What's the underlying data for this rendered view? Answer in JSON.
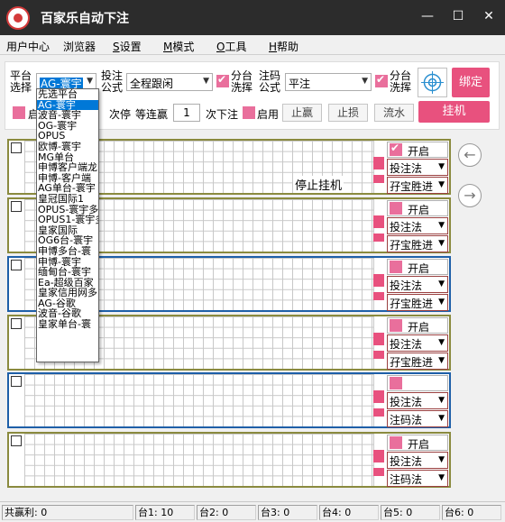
{
  "window": {
    "title": "百家乐自动下注",
    "min": "—",
    "max": "☐",
    "close": "✕"
  },
  "menu": {
    "user_center": "用户中心",
    "browser": "浏览器",
    "settings_key": "S",
    "settings": "设置",
    "mode_key": "M",
    "mode": "模式",
    "tools_key": "O",
    "tools": "工具",
    "help_key": "H",
    "help": "帮助"
  },
  "toolbar": {
    "platform_label_1": "平台",
    "platform_label_2": "选择",
    "platform_value": "AG-寰宇",
    "bet_label_1": "投注",
    "bet_label_2": "公式",
    "bet_value": "全程跟闲",
    "split_wash_1": "分台",
    "split_wash_2": "洗挥",
    "chip_label_1": "注码",
    "chip_label_2": "公式",
    "chip_value": "平注",
    "split_wash_b1": "分台",
    "split_wash_b2": "洗挥",
    "bind_button": "绑定",
    "row2_start": "启",
    "stop_after_label": "次停",
    "wait_wins_label": "等连赢",
    "wait_wins_value": "1",
    "next_bet_label": "次下注",
    "enable_label": "启用",
    "take_profit_button": "止赢",
    "stop_loss_button": "止损",
    "flow_button": "流水",
    "hang_button": "挂机"
  },
  "platform_options": [
    "先选平台",
    "AG-寰宇",
    "波音-寰宇",
    "OG-寰宇",
    "OPUS",
    "欧博-寰宇",
    "MG单台",
    "申博客户端龙",
    "申博-客户端",
    "AG单台-寰宇",
    "皇冠国际1",
    "OPUS-寰宇多",
    "OPUS1-寰宇多",
    "皇家国际",
    "OG6台-寰宇",
    "申博多台-寰",
    "申博-寰宇",
    "缅甸台-寰宇",
    "Ea-超级百家",
    "皇家信用网多",
    "AG-谷歌",
    "波音-谷歌",
    "皇家单台-寰"
  ],
  "panels": [
    {
      "open_label": "开启",
      "open_checked": true,
      "method": "投注法",
      "strategy": "孖宝胜进",
      "message": "停止挂机"
    },
    {
      "open_label": "开启",
      "open_checked": false,
      "method": "投注法",
      "strategy": "孖宝胜进",
      "message": ""
    },
    {
      "open_label": "开启",
      "open_checked": false,
      "method": "投注法",
      "strategy": "孖宝胜进",
      "message": ""
    },
    {
      "open_label": "开启",
      "open_checked": false,
      "method": "投注法",
      "strategy": "孖宝胜进",
      "message": ""
    },
    {
      "open_label": "",
      "open_checked": false,
      "method": "投注法",
      "strategy": "注码法",
      "message": ""
    },
    {
      "open_label": "开启",
      "open_checked": false,
      "method": "投注法",
      "strategy": "注码法",
      "message": ""
    }
  ],
  "nav": {
    "prev": "←",
    "next": "→"
  },
  "status": {
    "total": "共赢利: 0",
    "t1": "台1: 10",
    "t2": "台2: 0",
    "t3": "台3: 0",
    "t4": "台4: 0",
    "t5": "台5: 0",
    "t6": "台6: 0"
  },
  "colors": {
    "titlebar": "#2c2c2c",
    "accent_pink": "#e8517e",
    "panel_borders": [
      "#8a8a3e",
      "#8a8a3e",
      "#1e5fa8",
      "#8a8a3e",
      "#1e5fa8",
      "#8a8a3e"
    ]
  }
}
